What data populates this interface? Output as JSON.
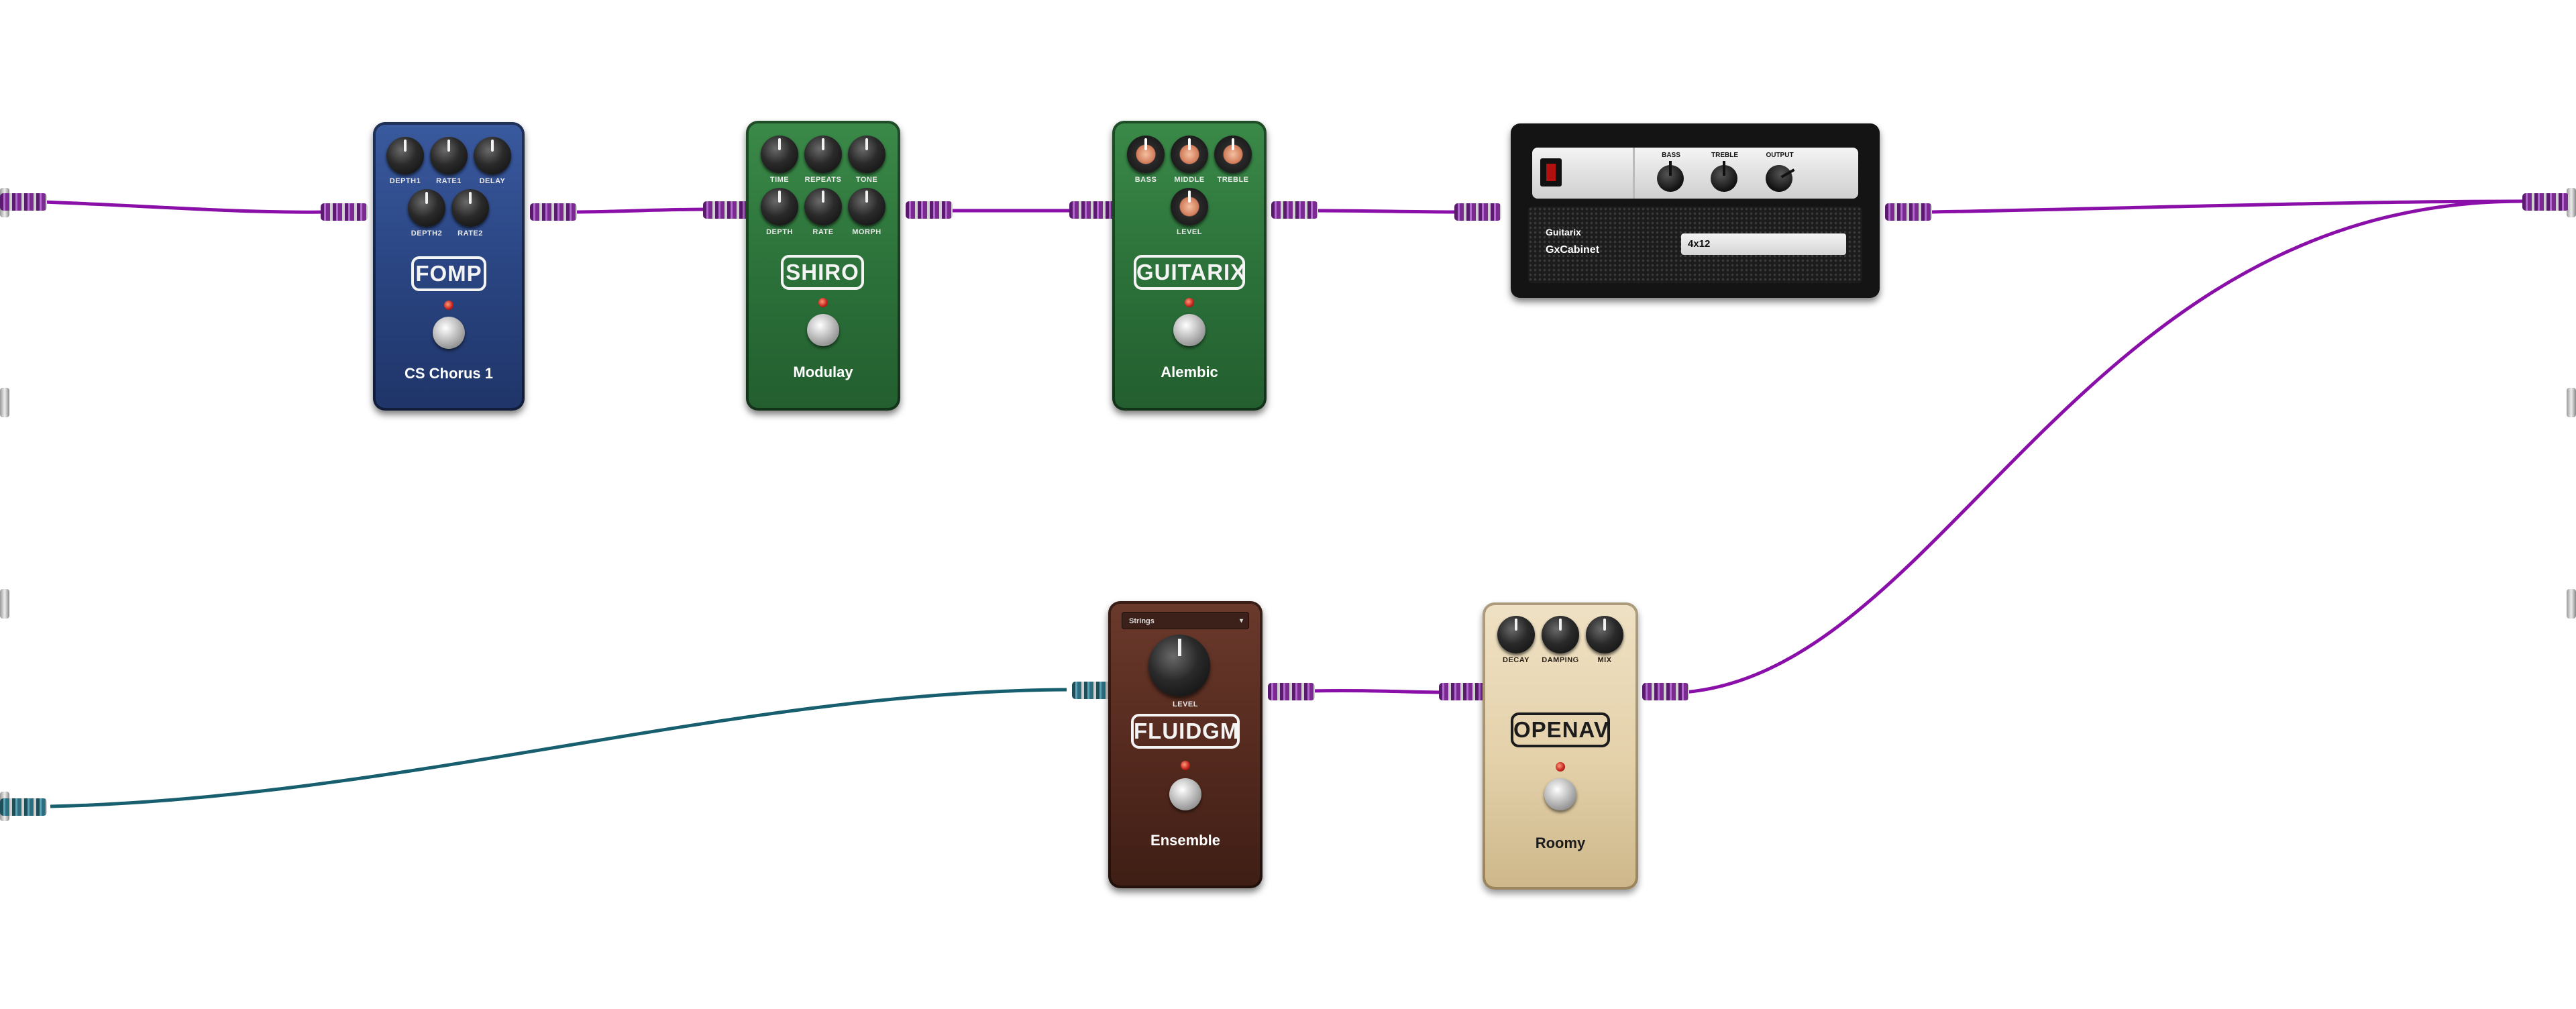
{
  "pedals": {
    "fomp": {
      "logo": "FOMP",
      "name": "CS Chorus 1",
      "knobs": [
        "DEPTH1",
        "RATE1",
        "DELAY",
        "DEPTH2",
        "RATE2"
      ]
    },
    "shiro": {
      "logo": "SHIRO",
      "name": "Modulay",
      "knobs": [
        "TIME",
        "REPEATS",
        "TONE",
        "DEPTH",
        "RATE",
        "MORPH"
      ]
    },
    "guitarix": {
      "logo": "GUITARIX",
      "name": "Alembic",
      "knobs": [
        "BASS",
        "MIDDLE",
        "TREBLE",
        "LEVEL"
      ]
    },
    "fluidgm": {
      "logo": "FLUIDGM",
      "name": "Ensemble",
      "select": "Strings",
      "knobs": [
        "LEVEL"
      ]
    },
    "openav": {
      "logo": "OPENAV",
      "name": "Roomy",
      "knobs": [
        "DECAY",
        "DAMPING",
        "MIX"
      ]
    }
  },
  "cabinet": {
    "brand": "Guitarix",
    "name": "GxCabinet",
    "model": "4x12",
    "knobs": [
      "BASS",
      "TREBLE",
      "OUTPUT"
    ]
  },
  "colors": {
    "cable_main": "#8a0fa8",
    "cable_input": "#175e6e"
  },
  "icons": {
    "select_chevron": "chevron-down-icon",
    "footswitch": "footswitch-icon"
  }
}
